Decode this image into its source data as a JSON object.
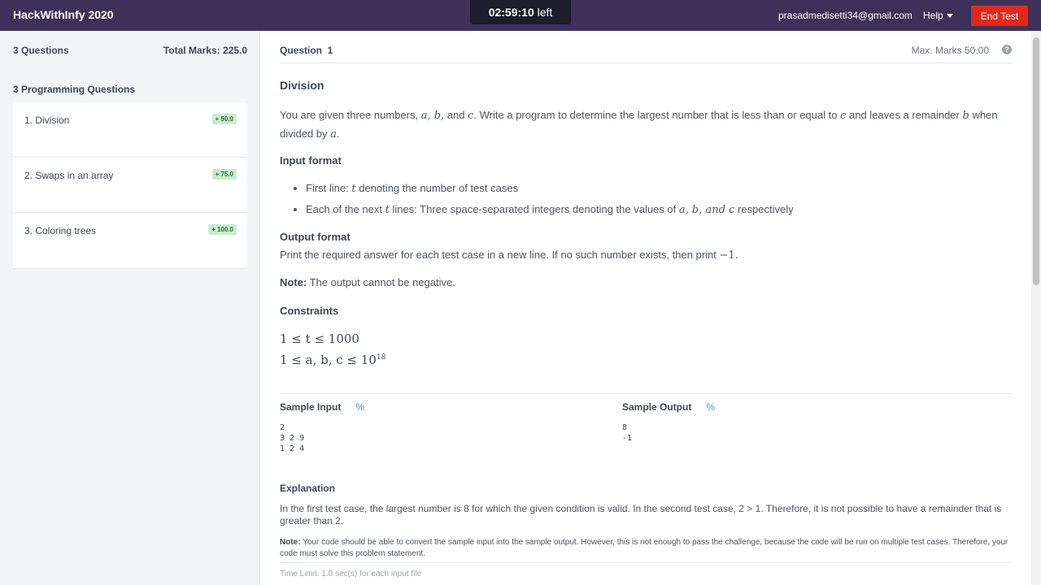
{
  "header": {
    "brand": "HackWithInfy 2020",
    "timer": "02:59:10",
    "timer_suffix": "left",
    "email": "prasadmedisetti34@gmail.com",
    "help": "Help",
    "end_test": "End Test",
    "colors": {
      "bar": "#3d3159",
      "end_test": "#e0291d"
    }
  },
  "sidebar": {
    "question_count": "3 Questions",
    "total_marks": "Total Marks: 225.0",
    "section": "3 Programming Questions",
    "questions": [
      {
        "label": "1. Division",
        "marks": "+ 50.0"
      },
      {
        "label": "2. Swaps in an array",
        "marks": "+ 75.0"
      },
      {
        "label": "3. Coloring trees",
        "marks": "+ 100.0"
      }
    ]
  },
  "question": {
    "header": "Question  1",
    "max_marks": "Max. Marks 50.00",
    "help_icon": "?",
    "title": "Division",
    "statement_1": "You are given three numbers,",
    "statement_vars": "a, b,",
    "statement_and": "and",
    "statement_c": "c",
    "statement_2": ". Write a program to determine the largest number that is less than or equal to",
    "statement_3": "and leaves a remainder",
    "statement_b": "b",
    "statement_4": "when divided by",
    "statement_a": "a",
    "statement_end": ".",
    "input_format_title": "Input format",
    "input_line1_pre": "First line:",
    "input_line1_var": "t",
    "input_line1_post": "denoting the number of test cases",
    "input_line2_pre": "Each of the next",
    "input_line2_var": "t",
    "input_line2_mid": "lines: Three space-separated integers denoting the values of",
    "input_line2_vars": "a, b,  and c",
    "input_line2_post": "respectively",
    "output_format_title": "Output format",
    "output_text": "Print the required answer for each test case in a new line. If no such number exists, then print",
    "output_value": "−1.",
    "note_label": "Note:",
    "note_text": "The output cannot be negative.",
    "constraints_title": "Constraints",
    "constraint_1": "1 ≤ t ≤ 1000",
    "constraint_2": "1 ≤ a, b, c ≤ 10",
    "constraint_2_exp": "18",
    "sample_input_title": "Sample Input",
    "sample_input": "2\n3 2 9\n1 2 4",
    "sample_output_title": "Sample Output",
    "sample_output": "8\n-1",
    "link_icon": "%",
    "explanation_title": "Explanation",
    "explanation": "In the first test case, the largest number is 8 for which the given condition is valid. In the second test case, 2 > 1. Therefore, it is not possible to have a remainder that is greater than 2.",
    "footer_note_label": "Note:",
    "footer_note": "Your code should be able to convert the sample input into the sample output. However, this is not enough to pass the challenge, because the code will be run on multiple test cases. Therefore, your code must solve this problem statement.",
    "time_limit": "Time Limit: 1.0 sec(s) for each input file"
  }
}
